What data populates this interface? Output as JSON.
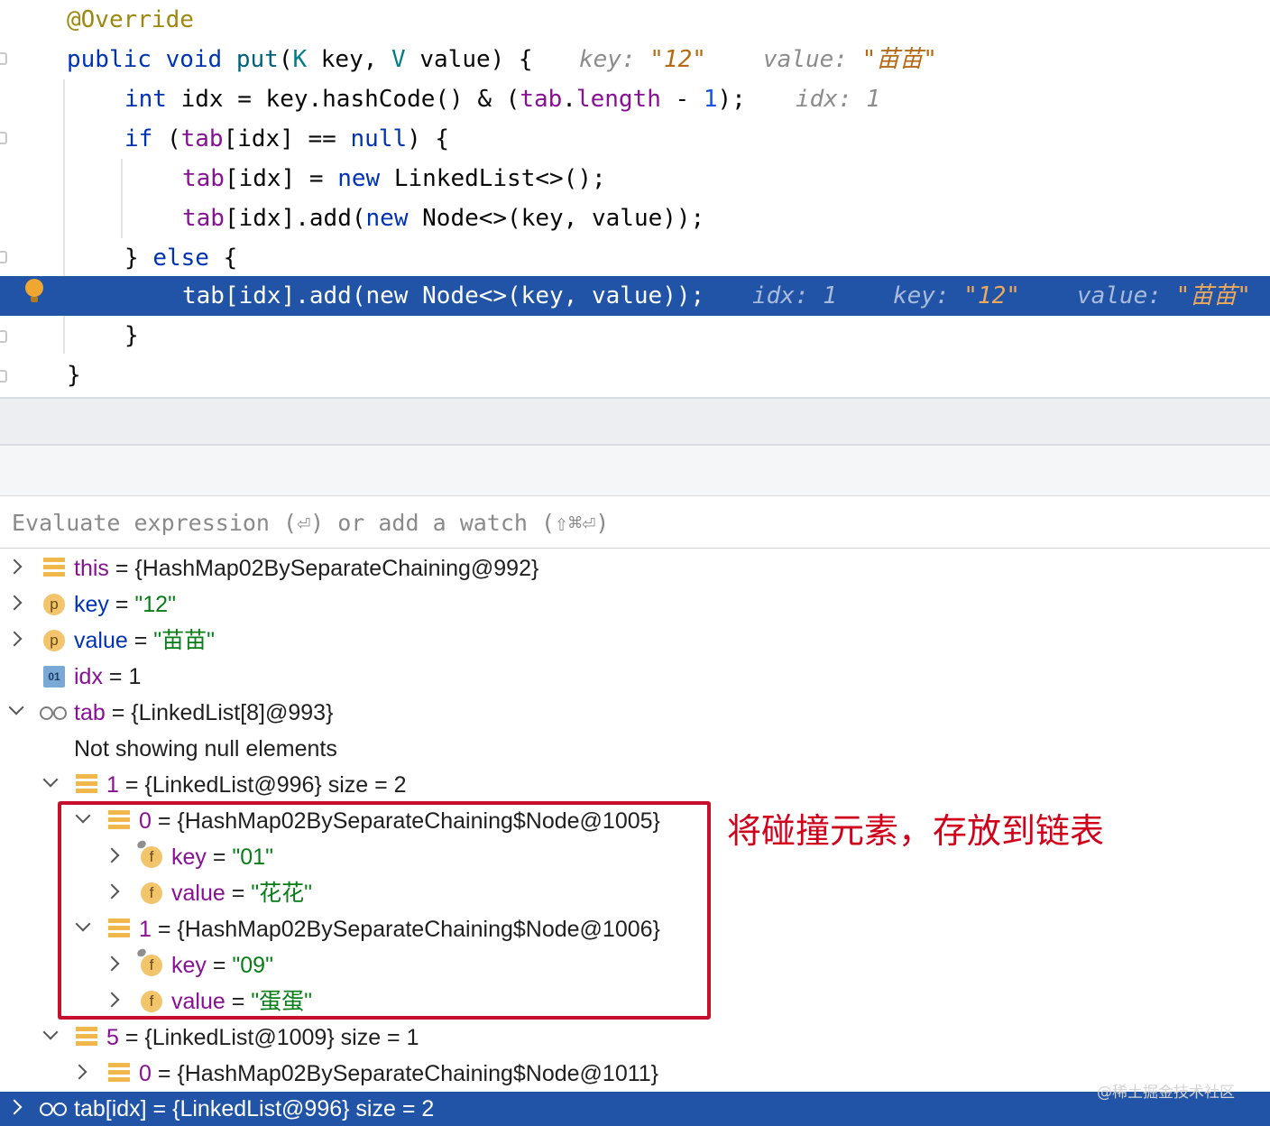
{
  "editor": {
    "lines": [
      {
        "text": "@Override"
      },
      {
        "pre": "public void ",
        "name": "put",
        "params_open": "(",
        "k": "K",
        "key": " key, ",
        "v": "V",
        "rest": " value) {",
        "hint": "key: ",
        "hint_val": "\"12\"",
        "hint2": "value: ",
        "hint2_val": "\"苗苗\""
      },
      {
        "kw": "int",
        "mid": " idx = key.hashCode() & (",
        "fld": "tab",
        "dot": ".",
        "fld2": "length",
        "minus": " - ",
        "num": "1",
        "end": ");",
        "hint": "idx: 1"
      },
      {
        "kw": "if",
        "open": " (",
        "fld": "tab",
        "rest": "[idx] == ",
        "kw2": "null",
        "end": ") {"
      },
      {
        "fld": "tab",
        "mid": "[idx] = ",
        "kw": "new",
        "rest": " LinkedList<>();"
      },
      {
        "fld": "tab",
        "mid": "[idx].add(",
        "kw": "new",
        "rest": " Node<>(key, value));"
      },
      {
        "brace": "} ",
        "kw": "else",
        "rest": " {"
      },
      {
        "text": "tab[idx].add(new Node<>(key, value));",
        "hint1": "idx: 1",
        "hint2": "key: ",
        "hint2_val": "\"12\"",
        "hint3": "value: ",
        "hint3_val": "\"苗苗\""
      },
      {
        "text": "}"
      },
      {
        "text": "}"
      }
    ]
  },
  "evaluate": {
    "placeholder": "Evaluate expression (⏎) or add a watch (⇧⌘⏎)"
  },
  "variables": [
    {
      "name": "this",
      "eq": " = ",
      "value": "{HashMap02BySeparateChaining@992}"
    },
    {
      "icon_letter": "p",
      "name": "key",
      "eq": " = ",
      "value": "\"12\""
    },
    {
      "icon_letter": "p",
      "name": "value",
      "eq": " = ",
      "value": "\"苗苗\""
    },
    {
      "icon_letter": "01",
      "name": "idx",
      "eq": " = ",
      "value": "1"
    },
    {
      "name": "tab",
      "eq": " = ",
      "value": "{LinkedList[8]@993}"
    },
    {
      "text": "Not showing null elements"
    },
    {
      "name": "1",
      "eq": " = ",
      "value": "{LinkedList@996}",
      "extra": "  size = 2"
    },
    {
      "name": "0",
      "eq": " = ",
      "value": "{HashMap02BySeparateChaining$Node@1005}"
    },
    {
      "icon_letter": "f",
      "name": "key",
      "eq": " = ",
      "value": "\"01\""
    },
    {
      "icon_letter": "f",
      "name": "value",
      "eq": " = ",
      "value": "\"花花\""
    },
    {
      "name": "1",
      "eq": " = ",
      "value": "{HashMap02BySeparateChaining$Node@1006}"
    },
    {
      "icon_letter": "f",
      "name": "key",
      "eq": " = ",
      "value": "\"09\""
    },
    {
      "icon_letter": "f",
      "name": "value",
      "eq": " = ",
      "value": "\"蛋蛋\""
    },
    {
      "name": "5",
      "eq": " = ",
      "value": "{LinkedList@1009}",
      "extra": "  size = 1"
    },
    {
      "name": "0",
      "eq": " = ",
      "value": "{HashMap02BySeparateChaining$Node@1011}"
    }
  ],
  "watch": {
    "name": "tab[idx]",
    "eq": " = ",
    "value": "{LinkedList@996}",
    "extra": "  size = 2"
  },
  "annotation": "将碰撞元素，存放到链表",
  "watermark": "@稀土掘金技术社区",
  "colors": {
    "selection": "#2154a6",
    "highlight_box": "#c8102e",
    "annotation": "#d0021b"
  }
}
